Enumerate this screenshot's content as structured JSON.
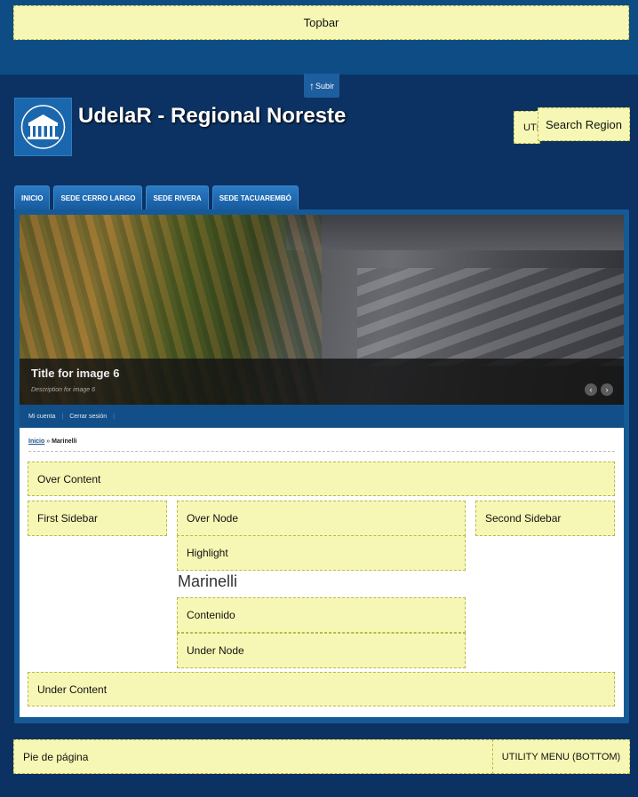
{
  "regions": {
    "topbar": "Topbar",
    "utility_top": "UTILITY MENU (TOP)",
    "search": "Search Region",
    "over_content": "Over Content",
    "first_sidebar": "First Sidebar",
    "over_node": "Over Node",
    "second_sidebar": "Second Sidebar",
    "highlight": "Highlight",
    "contenido": "Contenido",
    "under_node": "Under Node",
    "under_content": "Under Content",
    "footer": "Pie de página",
    "utility_bottom": "UTILITY MENU (BOTTOM)"
  },
  "subir": {
    "arrow": "↑",
    "label": "Subir"
  },
  "site": {
    "name": "UdelaR - Regional Noreste"
  },
  "nav": {
    "tabs": [
      "INICIO",
      "SEDE CERRO LARGO",
      "SEDE RIVERA",
      "SEDE TACUAREMBÓ"
    ]
  },
  "slideshow": {
    "title": "Title for image 6",
    "description": "Description for image 6",
    "prev": "‹",
    "next": "›"
  },
  "user_menu": [
    "Mi cuenta",
    "Cerrar sesión"
  ],
  "breadcrumb": {
    "home": "Inicio",
    "separator": " » ",
    "current": "Marinelli"
  },
  "node": {
    "title": "Marinelli"
  },
  "colors": {
    "background": "#0b3263",
    "header_band": "#0e4c86",
    "region_fill": "#f7f7b5",
    "tab": "#1d6bb3"
  }
}
